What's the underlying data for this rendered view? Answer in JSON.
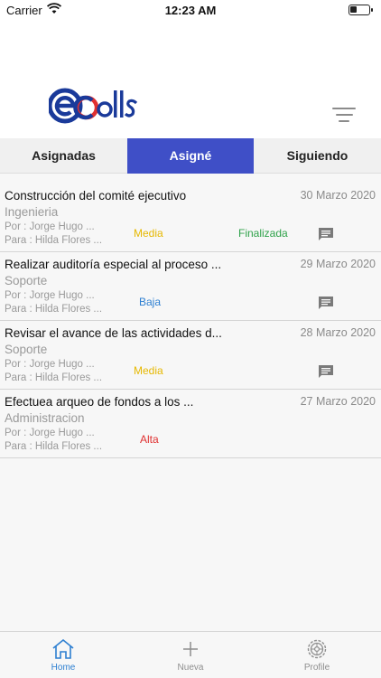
{
  "status_bar": {
    "carrier": "Carrier",
    "time": "12:23 AM"
  },
  "app": {
    "logo_text": "eColls",
    "brand_color": "#1a3a9a",
    "accent_color": "#3f4fc7"
  },
  "tabs": [
    {
      "label": "Asignadas",
      "active": false
    },
    {
      "label": "Asigné",
      "active": true
    },
    {
      "label": "Siguiendo",
      "active": false
    }
  ],
  "tasks": [
    {
      "title": "Construcción del comité ejecutivo",
      "date": "30 Marzo 2020",
      "department": "Ingenieria",
      "por": "Por : Jorge Hugo ...",
      "para": "Para : Hilda Flores ...",
      "priority": "Media",
      "priority_color": "#e6b800",
      "status": "Finalizada"
    },
    {
      "title": "Realizar auditoría especial al proceso ...",
      "date": "29 Marzo 2020",
      "department": "Soporte",
      "por": "Por : Jorge Hugo ...",
      "para": "Para : Hilda Flores ...",
      "priority": "Baja",
      "priority_color": "#2d7fd1",
      "status": ""
    },
    {
      "title": "Revisar el avance de las actividades d...",
      "date": "28 Marzo 2020",
      "department": "Soporte",
      "por": "Por : Jorge Hugo ...",
      "para": "Para : Hilda Flores ...",
      "priority": "Media",
      "priority_color": "#e6b800",
      "status": ""
    },
    {
      "title": "Efectuea arqueo de fondos a los ...",
      "date": "27 Marzo 2020",
      "department": "Administracion",
      "por": "Por : Jorge Hugo ...",
      "para": "Para : Hilda Flores ...",
      "priority": "Alta",
      "priority_color": "#e03030",
      "status": ""
    }
  ],
  "tabbar": [
    {
      "label": "Home",
      "icon": "home-icon",
      "active": true
    },
    {
      "label": "Nueva",
      "icon": "plus-icon",
      "active": false
    },
    {
      "label": "Profile",
      "icon": "gear-icon",
      "active": false
    }
  ]
}
